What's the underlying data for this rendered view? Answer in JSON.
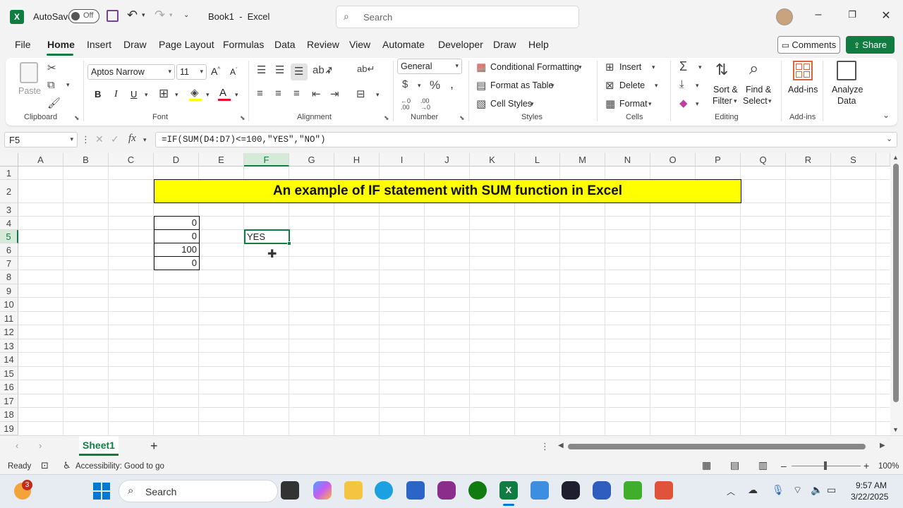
{
  "titlebar": {
    "autosave_label": "AutoSave",
    "autosave_state": "Off",
    "doc_title": "Book1  -  Excel",
    "search_placeholder": "Search"
  },
  "menu": {
    "tabs": [
      "File",
      "Home",
      "Insert",
      "Draw",
      "Page Layout",
      "Formulas",
      "Data",
      "Review",
      "View",
      "Automate",
      "Developer",
      "Draw",
      "Help"
    ],
    "active_tab": "Home",
    "comments_label": "Comments",
    "share_label": "Share"
  },
  "ribbon": {
    "clipboard": {
      "paste_label": "Paste",
      "group_label": "Clipboard"
    },
    "font": {
      "font_name": "Aptos Narrow",
      "font_size": "11",
      "bold": "B",
      "italic": "I",
      "underline": "U",
      "group_label": "Font"
    },
    "alignment": {
      "group_label": "Alignment"
    },
    "number": {
      "format": "General",
      "group_label": "Number"
    },
    "styles": {
      "conditional_formatting": "Conditional Formatting",
      "format_as_table": "Format as Table",
      "cell_styles": "Cell Styles",
      "group_label": "Styles"
    },
    "cells": {
      "insert": "Insert",
      "delete": "Delete",
      "format": "Format",
      "group_label": "Cells"
    },
    "editing": {
      "sort_filter_1": "Sort &",
      "sort_filter_2": "Filter",
      "find_select_1": "Find &",
      "find_select_2": "Select",
      "group_label": "Editing"
    },
    "addins": {
      "addins_label": "Add-ins",
      "group_label": "Add-ins"
    },
    "analyze": {
      "label_1": "Analyze",
      "label_2": "Data"
    }
  },
  "formula_bar": {
    "name_box": "F5",
    "fx": "fx",
    "formula": "=IF(SUM(D4:D7)<=100,\"YES\",\"NO\")"
  },
  "grid": {
    "columns": [
      "A",
      "B",
      "C",
      "D",
      "E",
      "F",
      "G",
      "H",
      "I",
      "J",
      "K",
      "L",
      "M",
      "N",
      "O",
      "P",
      "Q",
      "R",
      "S"
    ],
    "rows": [
      "1",
      "2",
      "3",
      "4",
      "5",
      "6",
      "7",
      "8",
      "9",
      "10",
      "11",
      "12",
      "13",
      "14",
      "15",
      "16",
      "17",
      "18",
      "19"
    ],
    "banner_text": "An example of IF statement with SUM function in Excel",
    "banner_color": "#ffff00",
    "d_values": [
      "0",
      "0",
      "100",
      "0"
    ],
    "active_cell_value": "YES",
    "active_cell": "F5"
  },
  "sheets": {
    "tabs": [
      "Sheet1"
    ],
    "add_sheet": "+"
  },
  "statusbar": {
    "ready": "Ready",
    "accessibility": "Accessibility: Good to go",
    "zoom": "100%"
  },
  "taskbar": {
    "search_placeholder": "Search",
    "widget_badge": "3",
    "time": "9:57 AM",
    "date": "3/22/2025"
  },
  "colors": {
    "excel_green": "#107c41",
    "accent": "#107c41"
  }
}
